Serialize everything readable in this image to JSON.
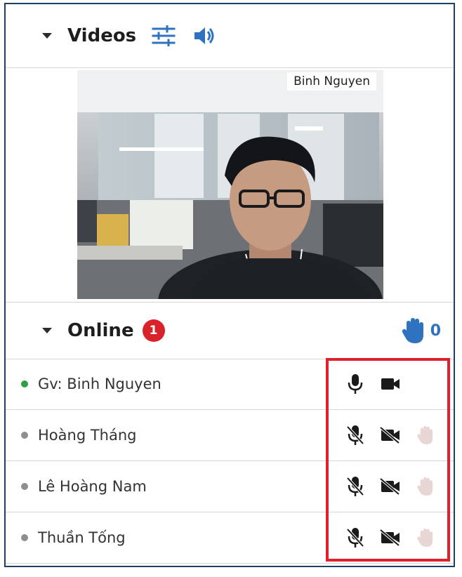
{
  "videos_panel": {
    "title": "Videos",
    "settings_icon": "sliders-icon",
    "audio_icon": "speaker-icon"
  },
  "video_feed": {
    "participant_name": "Binh Nguyen"
  },
  "online_panel": {
    "title": "Online",
    "count_badge": "1",
    "raised_hands_count": "0",
    "accent_color": "#2f73c0",
    "badge_color": "#d8232a"
  },
  "users": [
    {
      "name": "Gv: Binh Nguyen",
      "status": "online",
      "status_color": "#2ea043",
      "mic": "mic-on-icon",
      "camera": "camera-on-icon",
      "hand": ""
    },
    {
      "name": "Hoàng Tháng",
      "status": "idle",
      "status_color": "#8f8f8f",
      "mic": "mic-off-icon",
      "camera": "camera-off-icon",
      "hand": "hand-icon"
    },
    {
      "name": "Lê Hoàng Nam",
      "status": "idle",
      "status_color": "#8f8f8f",
      "mic": "mic-off-icon",
      "camera": "camera-off-icon",
      "hand": "hand-icon"
    },
    {
      "name": "Thuần Tống",
      "status": "idle",
      "status_color": "#8f8f8f",
      "mic": "mic-off-icon",
      "camera": "camera-off-icon",
      "hand": "hand-icon"
    }
  ]
}
